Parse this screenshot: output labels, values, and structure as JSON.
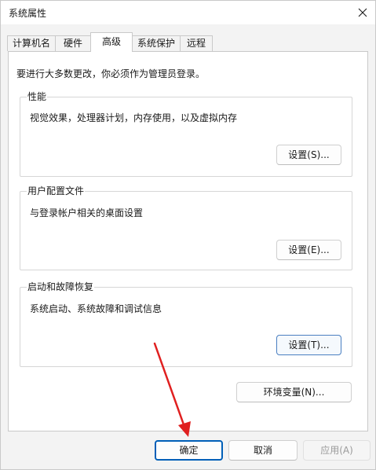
{
  "window": {
    "title": "系统属性"
  },
  "tabs": [
    {
      "label": "计算机名"
    },
    {
      "label": "硬件"
    },
    {
      "label": "高级",
      "active": true
    },
    {
      "label": "系统保护"
    },
    {
      "label": "远程"
    }
  ],
  "advanced": {
    "admin_note": "要进行大多数更改，你必须作为管理员登录。",
    "performance": {
      "title": "性能",
      "description": "视觉效果，处理器计划，内存使用，以及虚拟内存",
      "button": "设置(S)..."
    },
    "user_profiles": {
      "title": "用户配置文件",
      "description": "与登录帐户相关的桌面设置",
      "button": "设置(E)..."
    },
    "startup_recovery": {
      "title": "启动和故障恢复",
      "description": "系统启动、系统故障和调试信息",
      "button": "设置(T)..."
    },
    "env_button": "环境变量(N)..."
  },
  "footer": {
    "ok": "确定",
    "cancel": "取消",
    "apply": "应用(A)"
  },
  "colors": {
    "accent": "#005fb8",
    "annotation_arrow": "#e02020"
  },
  "icons": {
    "close": "close-icon"
  }
}
